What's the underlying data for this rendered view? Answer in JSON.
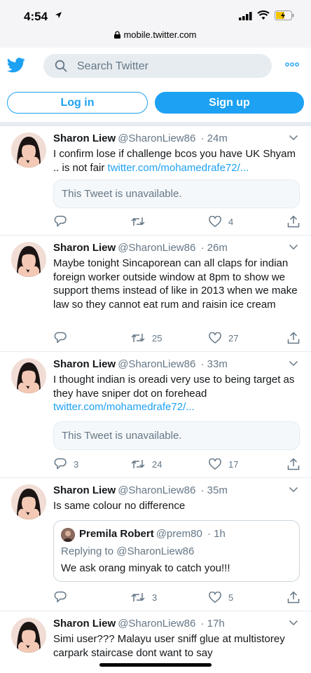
{
  "status_bar": {
    "time": "4:54",
    "url": "mobile.twitter.com"
  },
  "header": {
    "search_placeholder": "Search Twitter",
    "login_label": "Log in",
    "signup_label": "Sign up"
  },
  "tweets": [
    {
      "name": "Sharon Liew",
      "handle": "@SharonLiew86",
      "time": "· 24m",
      "text": "I confirm lose if challenge bcos you have UK Shyam .. is not fair ",
      "link": "twitter.com/mohamedrafe72/...",
      "unavailable": "This Tweet is unavailable.",
      "replies": "",
      "retweets": "",
      "likes": "4"
    },
    {
      "name": "Sharon Liew",
      "handle": "@SharonLiew86",
      "time": "· 26m",
      "text": "Maybe tonight Sincaporean can all claps for indian foreign worker outside window at 8pm to show we support thems instead of like in 2013 when we make law so they cannot eat rum and raisin ice cream",
      "replies": "",
      "retweets": "25",
      "likes": "27"
    },
    {
      "name": "Sharon Liew",
      "handle": "@SharonLiew86",
      "time": "· 33m",
      "text": "I thought indian is oreadi very use to being target as they have sniper dot on forehead",
      "link": "twitter.com/mohamedrafe72/...",
      "unavailable": "This Tweet is unavailable.",
      "replies": "3",
      "retweets": "24",
      "likes": "17"
    },
    {
      "name": "Sharon Liew",
      "handle": "@SharonLiew86",
      "time": "· 35m",
      "text": "Is same colour no difference",
      "quote": {
        "name": "Premila Robert",
        "handle": "@prem80",
        "time": "· 1h",
        "replying_to": "Replying to @SharonLiew86",
        "text": "We ask orang minyak to catch you!!!"
      },
      "replies": "",
      "retweets": "3",
      "likes": "5"
    },
    {
      "name": "Sharon Liew",
      "handle": "@SharonLiew86",
      "time": "· 17h",
      "text": "Simi user??? Malayu user sniff glue at multistorey carpark staircase dont want to say"
    }
  ],
  "colors": {
    "brand": "#1da1f2",
    "text": "#14171a",
    "secondary": "#657786",
    "divider": "#e6ecf0"
  },
  "icons": [
    "location-arrow-icon",
    "signal-icon",
    "wifi-icon",
    "battery-icon",
    "lock-icon",
    "twitter-bird-icon",
    "search-icon",
    "more-icon",
    "chevron-down-icon",
    "reply-icon",
    "retweet-icon",
    "like-icon",
    "share-icon"
  ]
}
